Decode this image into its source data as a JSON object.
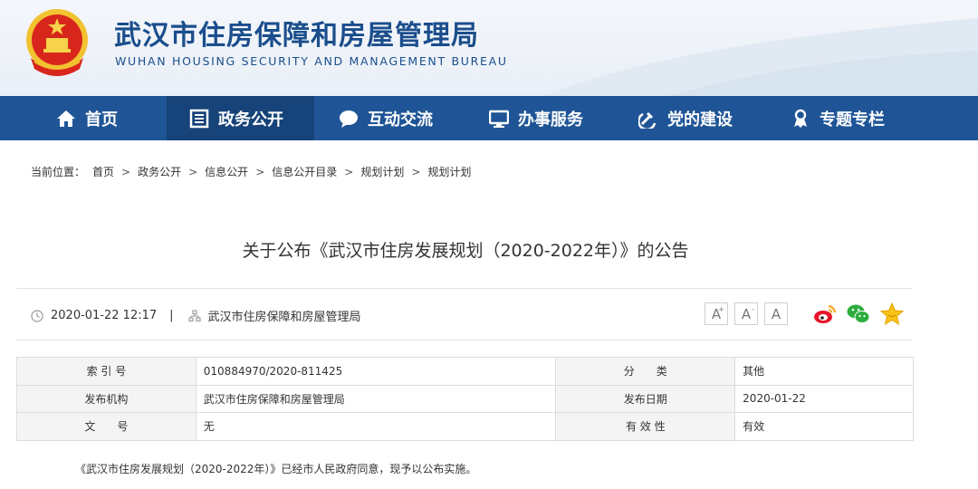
{
  "header": {
    "title": "武汉市住房保障和房屋管理局",
    "subtitle": "WUHAN HOUSING SECURITY AND MANAGEMENT BUREAU"
  },
  "nav": {
    "items": [
      {
        "label": "首页",
        "icon": "home-icon"
      },
      {
        "label": "政务公开",
        "icon": "document-icon",
        "active": true
      },
      {
        "label": "互动交流",
        "icon": "chat-icon"
      },
      {
        "label": "办事服务",
        "icon": "monitor-icon"
      },
      {
        "label": "党的建设",
        "icon": "party-icon"
      },
      {
        "label": "专题专栏",
        "icon": "column-icon"
      }
    ]
  },
  "breadcrumb": {
    "prefix": "当前位置：",
    "items": [
      "首页",
      "政务公开",
      "信息公开",
      "信息公开目录",
      "规划计划",
      "规划计划"
    ],
    "separator": ">"
  },
  "article": {
    "title": "关于公布《武汉市住房发展规划（2020-2022年）》的公告",
    "datetime": "2020-01-22 12:17",
    "divider": "|",
    "source": "武汉市住房保障和房屋管理局",
    "body": "《武汉市住房发展规划（2020-2022年）》已经市人民政府同意，现予以公布实施。"
  },
  "font_buttons": [
    {
      "label": "A",
      "sup": "+"
    },
    {
      "label": "A",
      "sup": "-"
    },
    {
      "label": "A",
      "sup": ""
    }
  ],
  "share": [
    "weibo-icon",
    "wechat-icon",
    "favorite-icon"
  ],
  "info_table": {
    "rows": [
      {
        "label1": "索 引 号",
        "value1": "010884970/2020-811425",
        "label2": "分　　类",
        "value2": "其他"
      },
      {
        "label1": "发布机构",
        "value1": "武汉市住房保障和房屋管理局",
        "label2": "发布日期",
        "value2": "2020-01-22"
      },
      {
        "label1": "文　　号",
        "value1": "无",
        "label2": "有 效 性",
        "value2": "有效"
      }
    ]
  },
  "colors": {
    "brand_blue": "#1f5596",
    "nav_active": "#164379",
    "title_blue": "#1b4e8c"
  }
}
